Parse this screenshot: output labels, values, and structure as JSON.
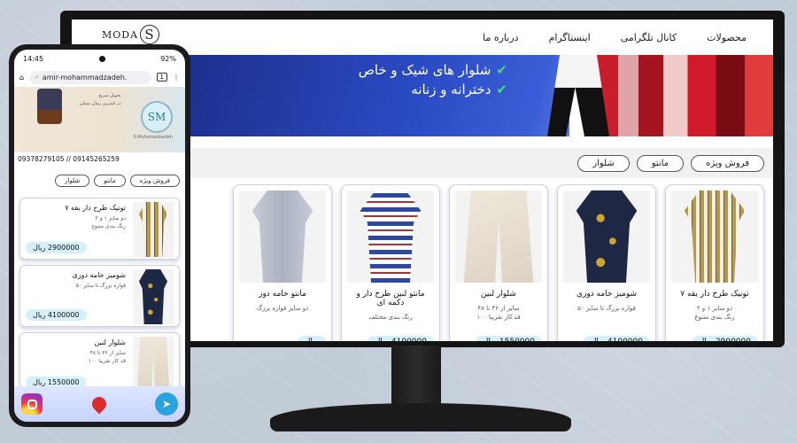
{
  "desktop": {
    "logo": {
      "letter": "S",
      "text": "MODA"
    },
    "nav": [
      "محصولات",
      "کانال تلگرامی",
      "اینستاگرام",
      "درباره ما"
    ],
    "banner_lines": [
      "شلوار های شیک و خاص",
      "دخترانه و زنانه"
    ],
    "filters": [
      "فروش ویژه",
      "مانتو",
      "شلوار"
    ],
    "products": [
      {
        "title": "تونیک طرح دار یقه ۷",
        "desc1": "دو سایز ۱ و ۲",
        "desc2": "رنگ بندی متنوع",
        "price": "2900000",
        "img": "stripes"
      },
      {
        "title": "شومیز خامه دوزی",
        "desc1": "قواره بزرگ تا سایز ۵۰",
        "desc2": "",
        "price": "4100000",
        "img": "navy"
      },
      {
        "title": "شلوار لنین",
        "desc1": "سایز از ۳۶ تا ۴۸",
        "desc2": "قد کار تقریبا ۱۰۰",
        "price": "1550000",
        "img": "beige"
      },
      {
        "title": "مانتو لنین طرح دار و دکمه ای",
        "desc1": "رنگ بندی مختلف",
        "desc2": "",
        "price": "4100000",
        "img": "pattern"
      },
      {
        "title": "مانتو خامه دوز",
        "desc1": "دو سایز قواره بزرگ",
        "desc2": "",
        "price": "",
        "img": "grey"
      }
    ],
    "currency": "ریال"
  },
  "phone": {
    "time": "14:45",
    "battery": "92%",
    "url": "amir-mohammadzadeh.",
    "tab_count": "1",
    "badge": "SM",
    "badge_caption": "S.Mohamadzadeh",
    "banner_line1": "تحویل سریع",
    "banner_line2": "در کمترین زمان ممکن",
    "contact": "09378279105 // 09145265259",
    "filters": [
      "فروش ویژه",
      "مانتو",
      "شلوار"
    ],
    "products": [
      {
        "title": "تونیک طرح دار یقه ۷",
        "desc1": "دو سایز ۱ و ۲",
        "desc2": "رنگ بندی متنوع",
        "price": "2900000",
        "img": "stripes"
      },
      {
        "title": "شومیز خامه دوزی",
        "desc1": "قواره بزرگ تا سایز ۵۰",
        "desc2": "",
        "price": "4100000",
        "img": "navy"
      },
      {
        "title": "شلوار لنین",
        "desc1": "سایز از ۳۶ تا ۴۸",
        "desc2": "قد کار تقریبا ۱۰۰",
        "price": "1550000",
        "img": "beige"
      }
    ],
    "currency": "ریال",
    "telegram_glyph": "➤"
  },
  "colors": {
    "accent": "#d6f0fa",
    "brand_blue": "#2b4bc4"
  }
}
